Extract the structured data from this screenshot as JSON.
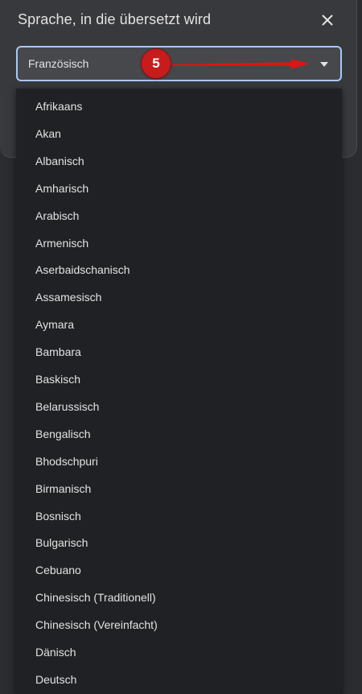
{
  "dialog": {
    "title": "Sprache, in die übersetzt wird",
    "close_icon": "close-icon"
  },
  "select": {
    "value": "Französisch",
    "caret_icon": "caret-down-icon"
  },
  "dropdown": {
    "options": [
      "Afrikaans",
      "Akan",
      "Albanisch",
      "Amharisch",
      "Arabisch",
      "Armenisch",
      "Aserbaidschanisch",
      "Assamesisch",
      "Aymara",
      "Bambara",
      "Baskisch",
      "Belarussisch",
      "Bengalisch",
      "Bhodschpuri",
      "Birmanisch",
      "Bosnisch",
      "Bulgarisch",
      "Cebuano",
      "Chinesisch (Traditionell)",
      "Chinesisch (Vereinfacht)",
      "Dänisch",
      "Deutsch"
    ]
  },
  "annotation": {
    "step_number": "5",
    "color": "#e01414"
  }
}
